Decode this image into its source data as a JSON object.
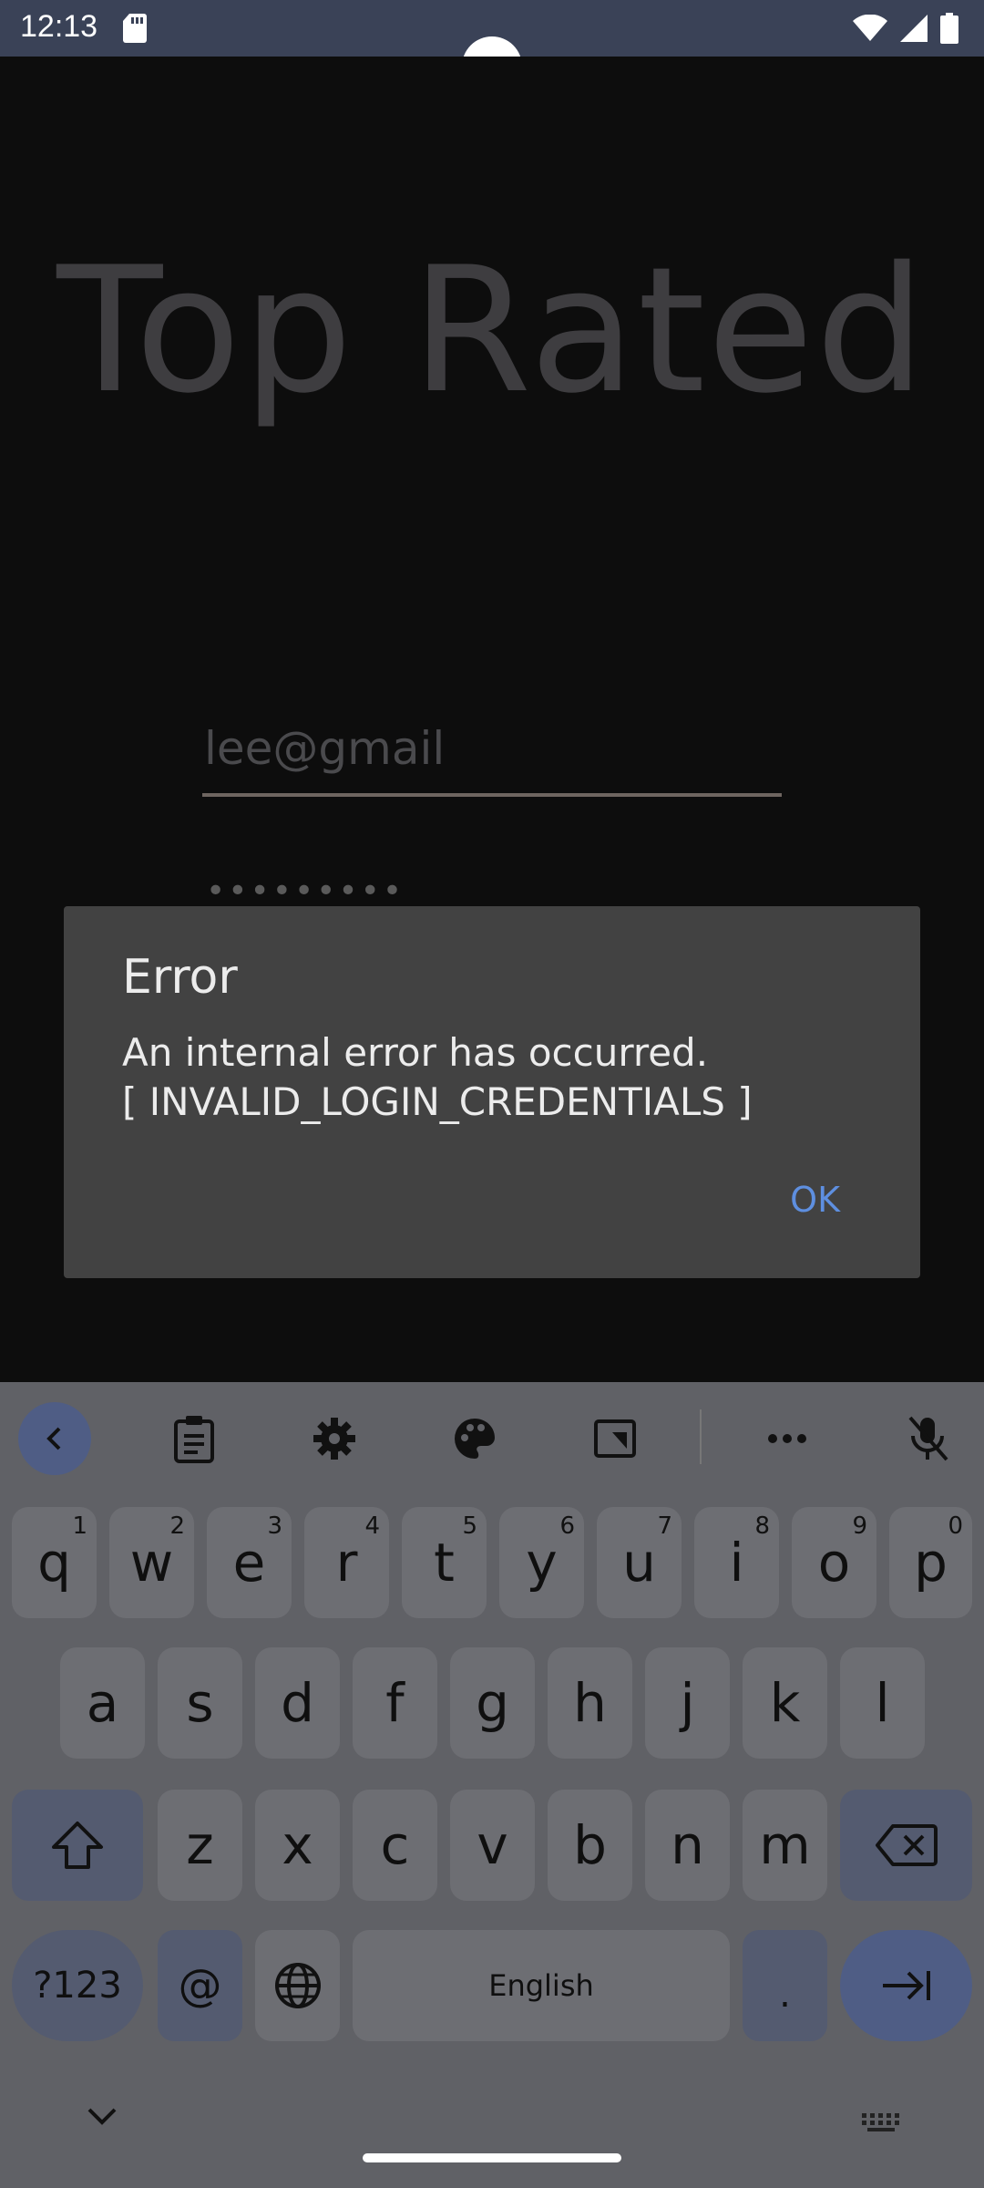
{
  "status_bar": {
    "time": "12:13",
    "icons": [
      "sd-card-icon",
      "wifi-icon",
      "signal-icon",
      "battery-icon"
    ]
  },
  "app": {
    "title": "Top Rated",
    "email_value": "lee@gmail",
    "password_value": "•••••••••"
  },
  "dialog": {
    "title": "Error",
    "message_line1": "An internal error has occurred.",
    "message_line2": "[ INVALID_LOGIN_CREDENTIALS ]",
    "ok_label": "OK",
    "ok_color": "#5e8fe0"
  },
  "keyboard": {
    "toolbar_icons": [
      "back-icon",
      "clipboard-icon",
      "settings-icon",
      "palette-icon",
      "resize-icon",
      "more-icon",
      "mic-off-icon"
    ],
    "row1": [
      {
        "label": "q",
        "hint": "1"
      },
      {
        "label": "w",
        "hint": "2"
      },
      {
        "label": "e",
        "hint": "3"
      },
      {
        "label": "r",
        "hint": "4"
      },
      {
        "label": "t",
        "hint": "5"
      },
      {
        "label": "y",
        "hint": "6"
      },
      {
        "label": "u",
        "hint": "7"
      },
      {
        "label": "i",
        "hint": "8"
      },
      {
        "label": "o",
        "hint": "9"
      },
      {
        "label": "p",
        "hint": "0"
      }
    ],
    "row2": [
      "a",
      "s",
      "d",
      "f",
      "g",
      "h",
      "j",
      "k",
      "l"
    ],
    "row3": [
      "z",
      "x",
      "c",
      "v",
      "b",
      "n",
      "m"
    ],
    "symbols_label": "?123",
    "at_label": "@",
    "space_label": "English",
    "period_label": "."
  }
}
